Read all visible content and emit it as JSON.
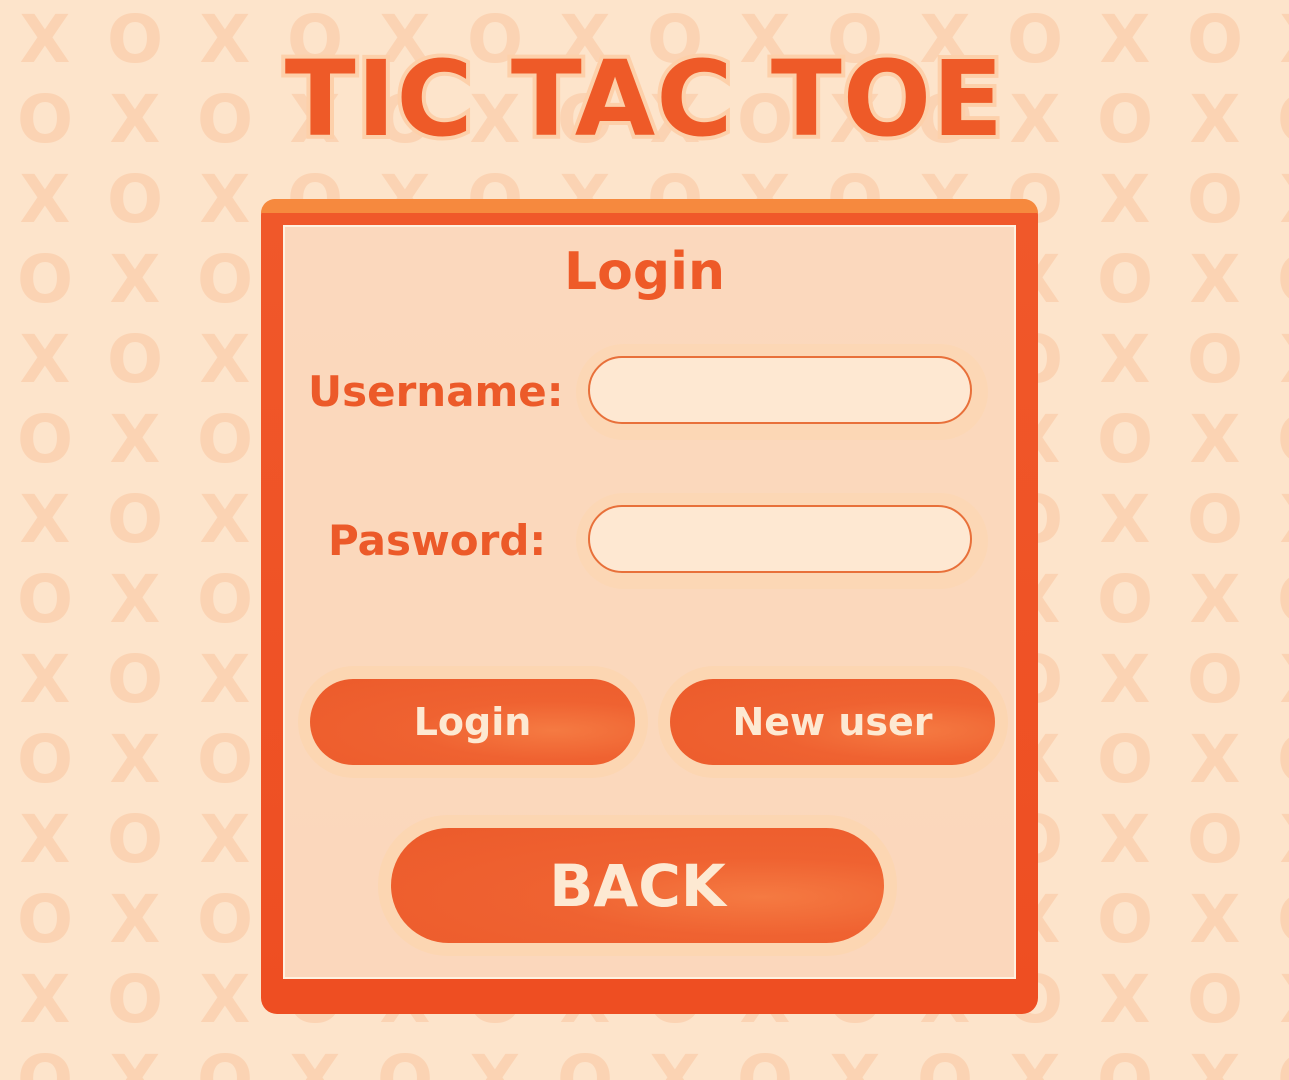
{
  "app": {
    "title": "TIC TAC TOE"
  },
  "background": {
    "glyphs": [
      "X",
      "O"
    ]
  },
  "login_panel": {
    "title": "Login",
    "username": {
      "label": "Username:",
      "value": "",
      "placeholder": ""
    },
    "password": {
      "label": "Pasword:",
      "value": "",
      "placeholder": ""
    },
    "buttons": {
      "login_label": "Login",
      "new_user_label": "New user",
      "back_label": "BACK"
    }
  },
  "colors": {
    "accent": "#ee5a28",
    "background": "#fde4cb",
    "panel_border": "#f0582a",
    "button_text": "#fde9d2",
    "pattern": "#fbd3b3"
  }
}
